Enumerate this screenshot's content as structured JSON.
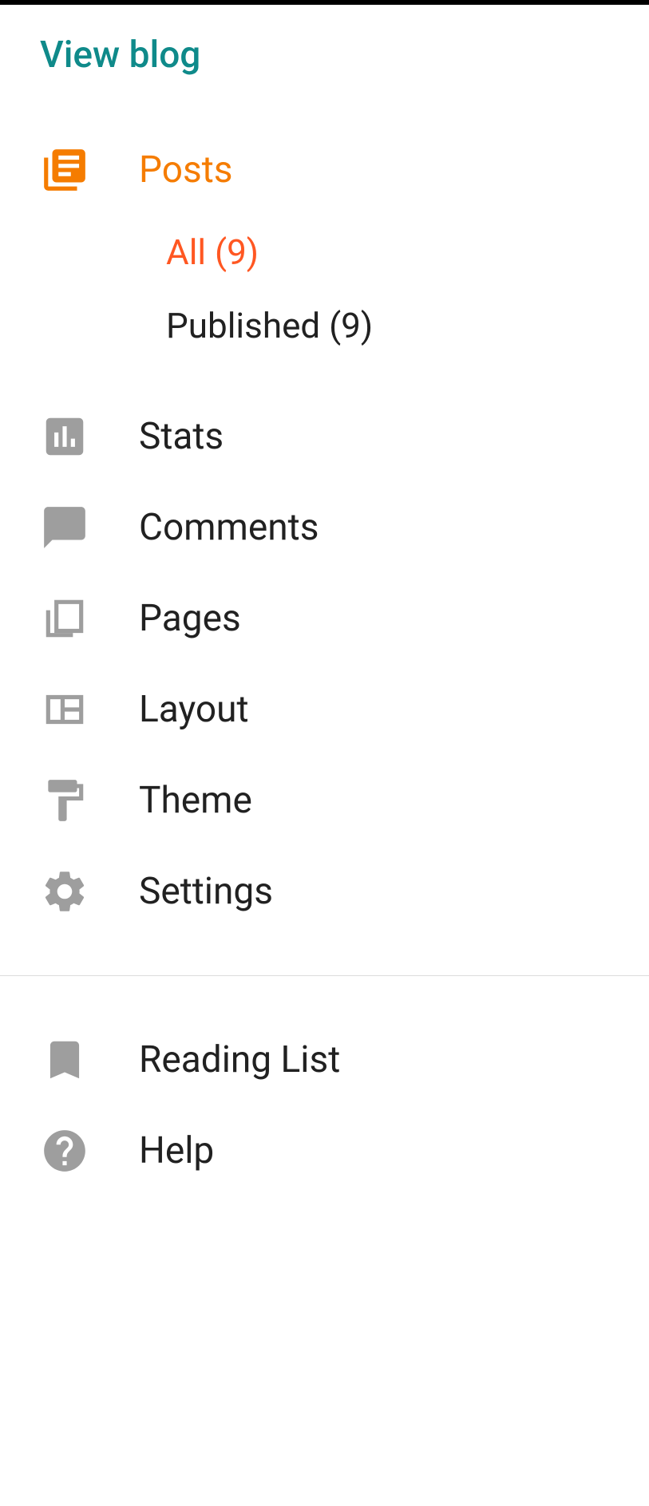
{
  "viewBlog": "View blog",
  "nav": {
    "posts": "Posts",
    "stats": "Stats",
    "comments": "Comments",
    "pages": "Pages",
    "layout": "Layout",
    "theme": "Theme",
    "settings": "Settings",
    "readingList": "Reading List",
    "help": "Help"
  },
  "subNav": {
    "all": "All (9)",
    "published": "Published (9)"
  }
}
